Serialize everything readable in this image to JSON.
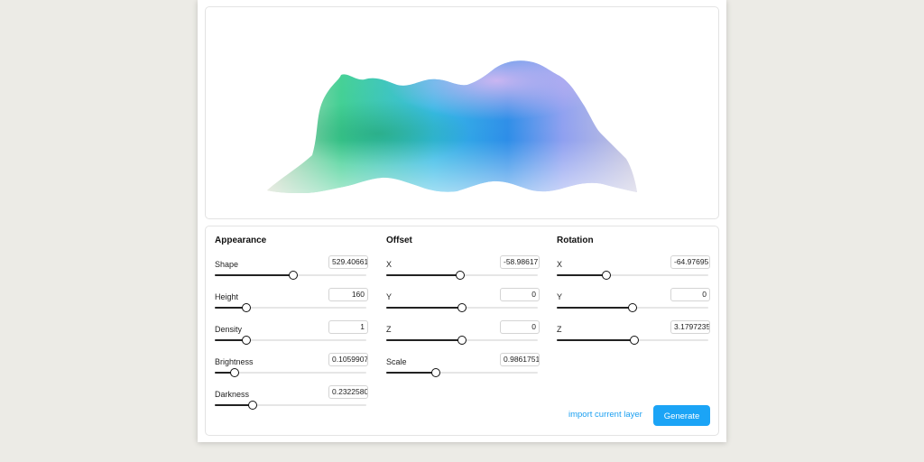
{
  "colors": {
    "accent": "#1ba4f6",
    "link": "#1b9ff0",
    "background": "#ecebe6",
    "terrain_gradient": [
      "#c9d3b9",
      "#3fcf92",
      "#32b8e8",
      "#2e8fe8",
      "#b9a8f0"
    ]
  },
  "columns": [
    {
      "title": "Appearance",
      "controls": [
        {
          "label": "Shape",
          "value": "529.40661",
          "fraction": 0.52
        },
        {
          "label": "Height",
          "value": "160",
          "fraction": 0.21
        },
        {
          "label": "Density",
          "value": "1",
          "fraction": 0.21
        },
        {
          "label": "Brightness",
          "value": "0.1059907",
          "fraction": 0.13
        },
        {
          "label": "Darkness",
          "value": "0.2322580",
          "fraction": 0.25
        }
      ]
    },
    {
      "title": "Offset",
      "controls": [
        {
          "label": "X",
          "value": "-58.98617",
          "fraction": 0.49
        },
        {
          "label": "Y",
          "value": "0",
          "fraction": 0.5
        },
        {
          "label": "Z",
          "value": "0",
          "fraction": 0.5
        },
        {
          "label": "Scale",
          "value": "0.9861751",
          "fraction": 0.33
        }
      ]
    },
    {
      "title": "Rotation",
      "controls": [
        {
          "label": "X",
          "value": "-64.97695",
          "fraction": 0.33
        },
        {
          "label": "Y",
          "value": "0",
          "fraction": 0.5
        },
        {
          "label": "Z",
          "value": "3.1797235",
          "fraction": 0.51
        }
      ]
    }
  ],
  "actions": {
    "import_label": "import current layer",
    "generate_label": "Generate"
  }
}
